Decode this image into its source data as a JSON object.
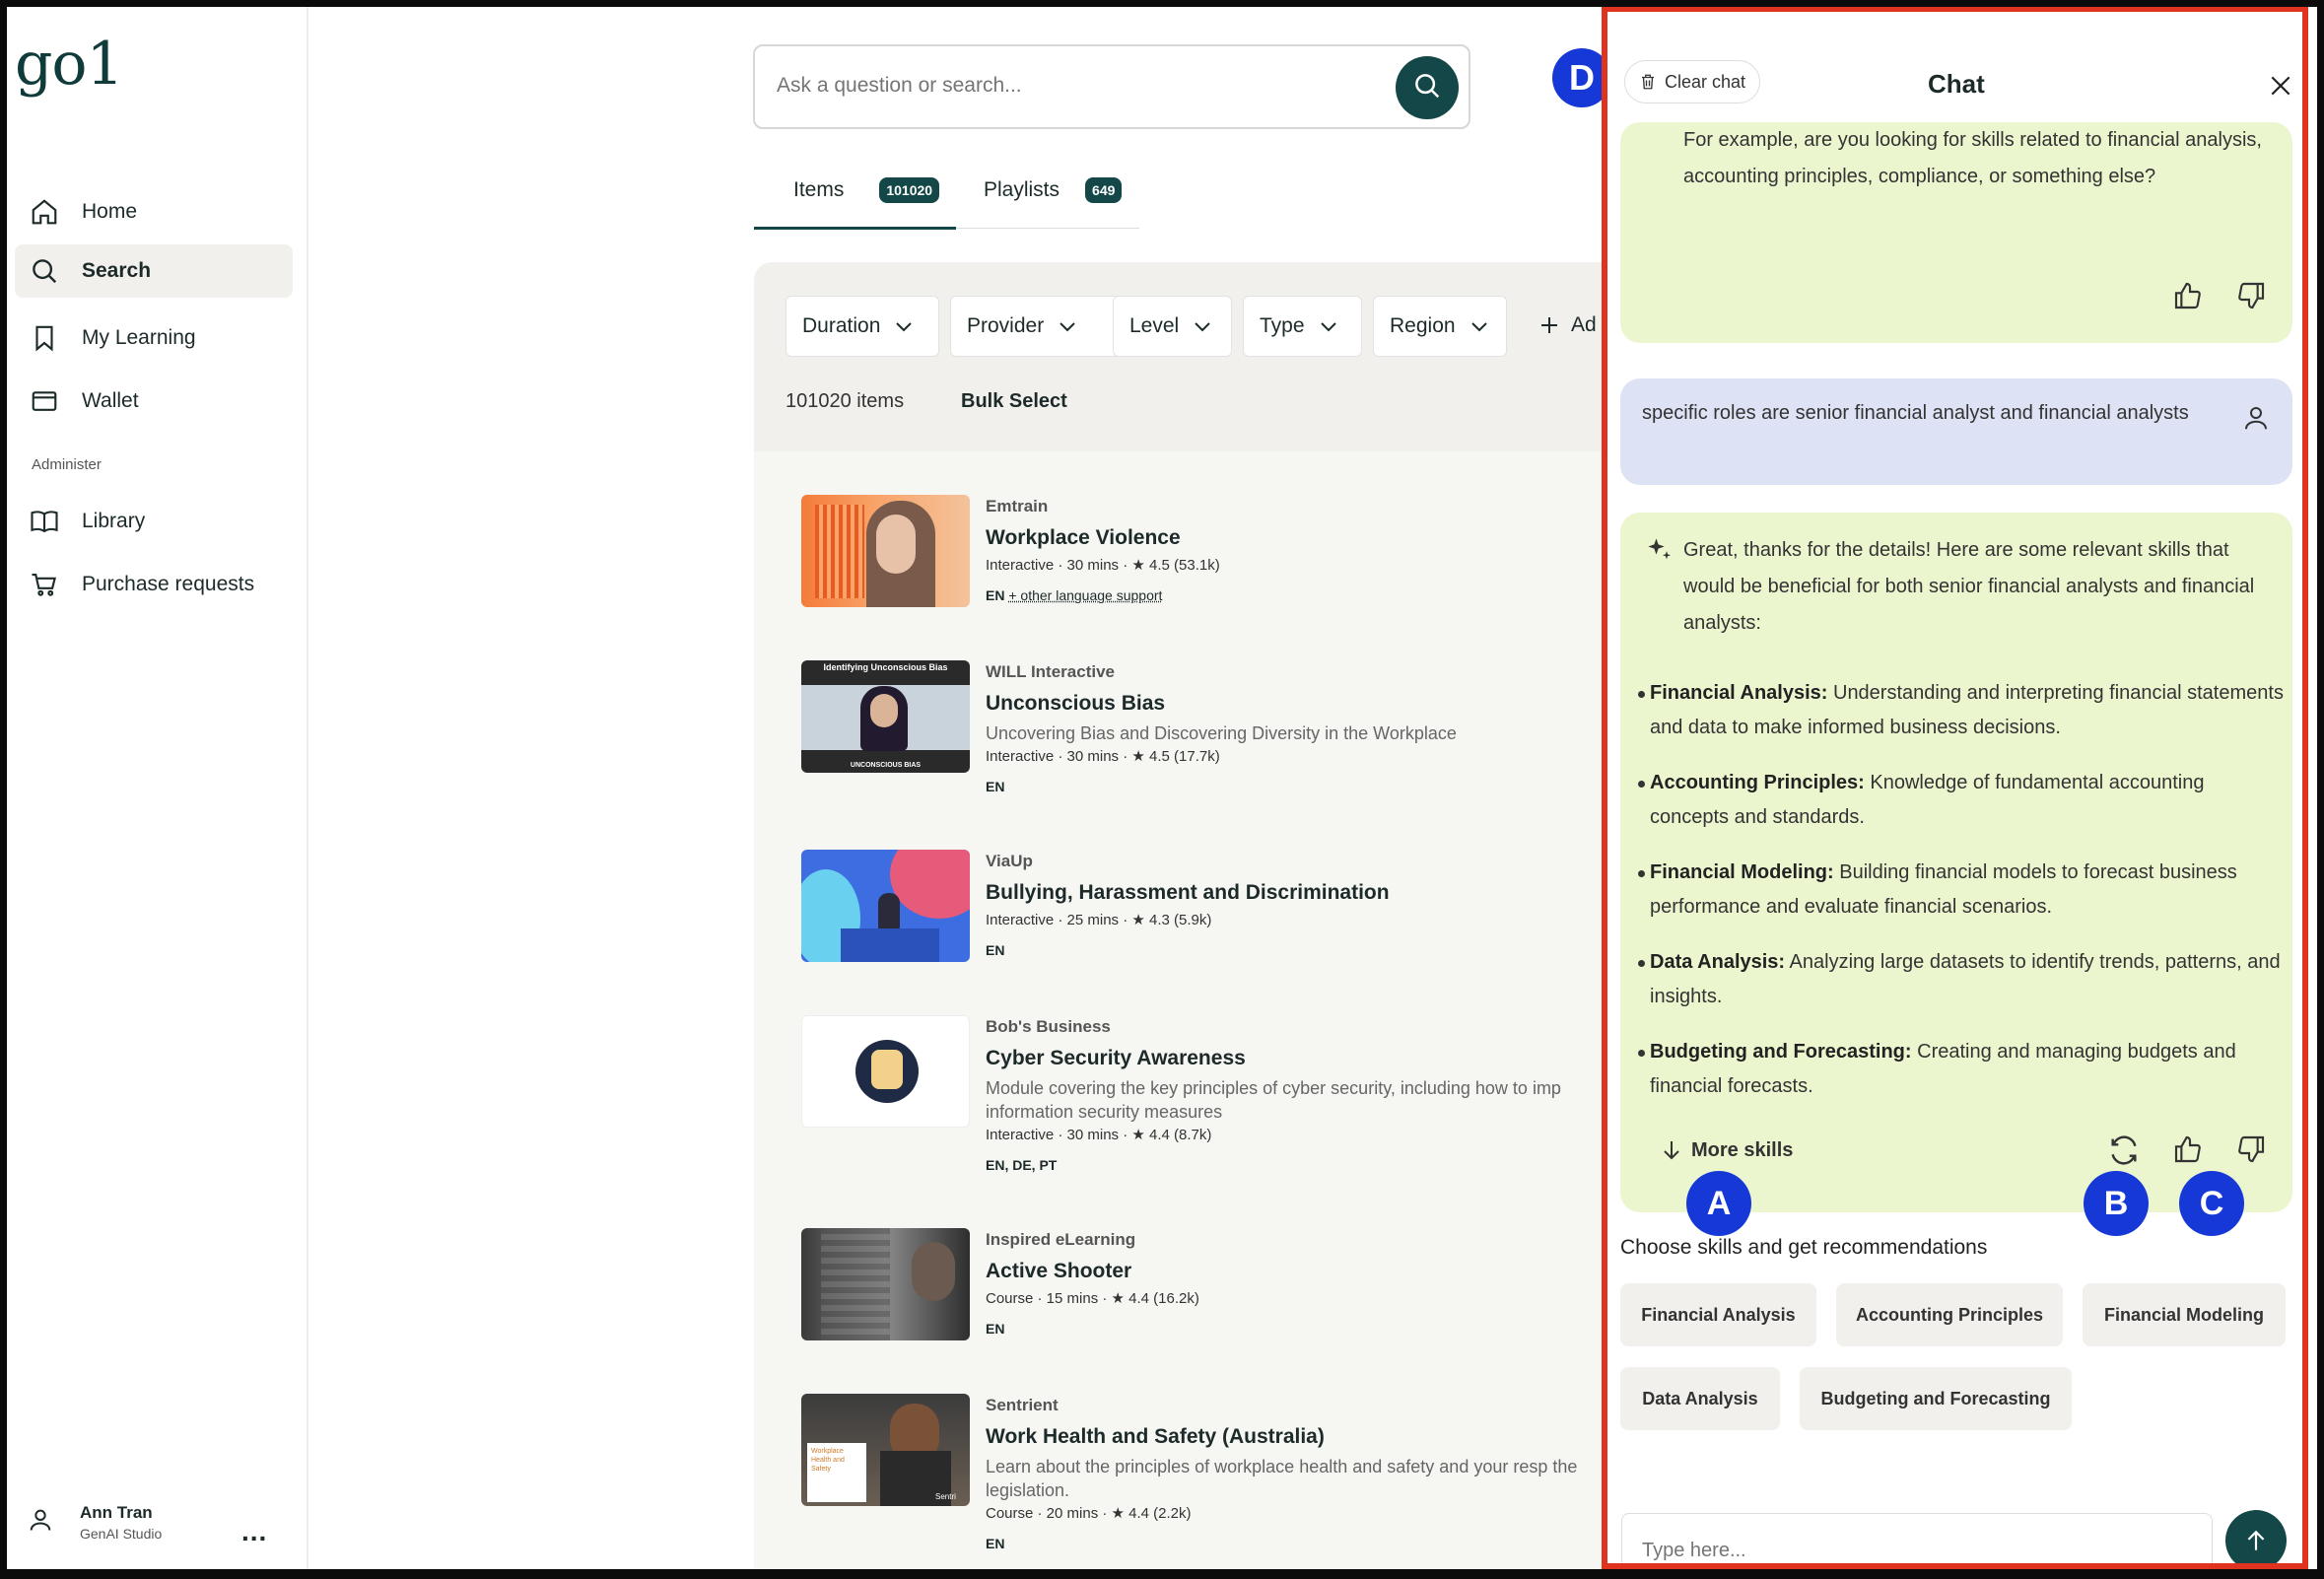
{
  "sidebar": {
    "logo": "go1",
    "nav": [
      {
        "label": "Home",
        "icon": "home-icon"
      },
      {
        "label": "Search",
        "icon": "search-icon"
      },
      {
        "label": "My Learning",
        "icon": "bookmark-icon"
      },
      {
        "label": "Wallet",
        "icon": "wallet-icon"
      }
    ],
    "section_label": "Administer",
    "admin_nav": [
      {
        "label": "Library",
        "icon": "book-icon"
      },
      {
        "label": "Purchase requests",
        "icon": "cart-icon"
      }
    ],
    "user": {
      "name": "Ann Tran",
      "role": "GenAI Studio",
      "more": "..."
    }
  },
  "search": {
    "placeholder": "Ask a question or search..."
  },
  "avatar_initial": "D",
  "tabs": [
    {
      "label": "Items",
      "count": "101020"
    },
    {
      "label": "Playlists",
      "count": "649"
    }
  ],
  "filters": {
    "buttons": [
      "Duration",
      "Provider",
      "Level",
      "Type",
      "Region"
    ],
    "add_label": "Ad",
    "items_count": "101020 items",
    "bulk_select": "Bulk Select"
  },
  "results": [
    {
      "provider": "Emtrain",
      "title": "Workplace Violence",
      "description": "",
      "meta": "Interactive · 30 mins · ★ 4.5 (53.1k)",
      "lang": "EN",
      "lang_extra": "+ other language support"
    },
    {
      "provider": "WILL Interactive",
      "title": "Unconscious Bias",
      "description": "Uncovering Bias and Discovering Diversity in the Workplace",
      "meta": "Interactive · 30 mins · ★ 4.5 (17.7k)",
      "lang": "EN",
      "lang_extra": "",
      "thumb_text_top": "Identifying Unconscious Bias",
      "thumb_text_bottom": "UNCONSCIOUS BIAS"
    },
    {
      "provider": "ViaUp",
      "title": "Bullying, Harassment and Discrimination",
      "description": "",
      "meta": "Interactive · 25 mins · ★ 4.3 (5.9k)",
      "lang": "EN",
      "lang_extra": ""
    },
    {
      "provider": "Bob's Business",
      "title": "Cyber Security Awareness",
      "description": "Module covering the key principles of cyber security, including how to imp information security measures",
      "meta": "Interactive · 30 mins · ★ 4.4 (8.7k)",
      "lang": "EN, DE, PT",
      "lang_extra": ""
    },
    {
      "provider": "Inspired eLearning",
      "title": "Active Shooter",
      "description": "",
      "meta": "Course · 15 mins · ★ 4.4 (16.2k)",
      "lang": "EN",
      "lang_extra": ""
    },
    {
      "provider": "Sentrient",
      "title": "Work Health and Safety (Australia)",
      "description": "Learn about the principles of workplace health and safety and your resp the legislation.",
      "meta": "Course · 20 mins · ★ 4.4 (2.2k)",
      "lang": "EN",
      "lang_extra": "",
      "thumb_text_top": "Workplace Health and Safety",
      "thumb_text_bottom": "Sentri"
    }
  ],
  "chat": {
    "clear_label": "Clear chat",
    "title": "Chat",
    "msg1": "For example, are you looking for skills related to financial analysis, accounting principles, compliance, or something else?",
    "user_msg": "specific roles are senior financial analyst and financial analysts",
    "msg2_intro": "Great, thanks for the details! Here are some relevant skills that would be beneficial for both senior financial analysts and financial analysts:",
    "skills": [
      {
        "name": "Financial Analysis:",
        "desc": " Understanding and interpreting financial statements and data to make informed business decisions."
      },
      {
        "name": "Accounting Principles:",
        "desc": " Knowledge of fundamental accounting concepts and standards."
      },
      {
        "name": "Financial Modeling:",
        "desc": " Building financial models to forecast business performance and evaluate financial scenarios."
      },
      {
        "name": "Data Analysis:",
        "desc": " Analyzing large datasets to identify trends, patterns, and insights."
      },
      {
        "name": "Budgeting and Forecasting:",
        "desc": " Creating and managing budgets and financial forecasts."
      }
    ],
    "more_skills": "More skills",
    "markers": [
      "A",
      "B",
      "C"
    ],
    "choose_label": "Choose skills and get recommendations",
    "chips": [
      "Financial Analysis",
      "Accounting Principles",
      "Financial Modeling",
      "Data Analysis",
      "Budgeting and Forecasting"
    ],
    "input_placeholder": "Type here..."
  },
  "colors": {
    "brand": "#144848",
    "chat_ai_bg": "#ebf6cf",
    "chat_user_bg": "#dde3f5",
    "marker": "#1638d6",
    "highlight": "#e0331f"
  }
}
